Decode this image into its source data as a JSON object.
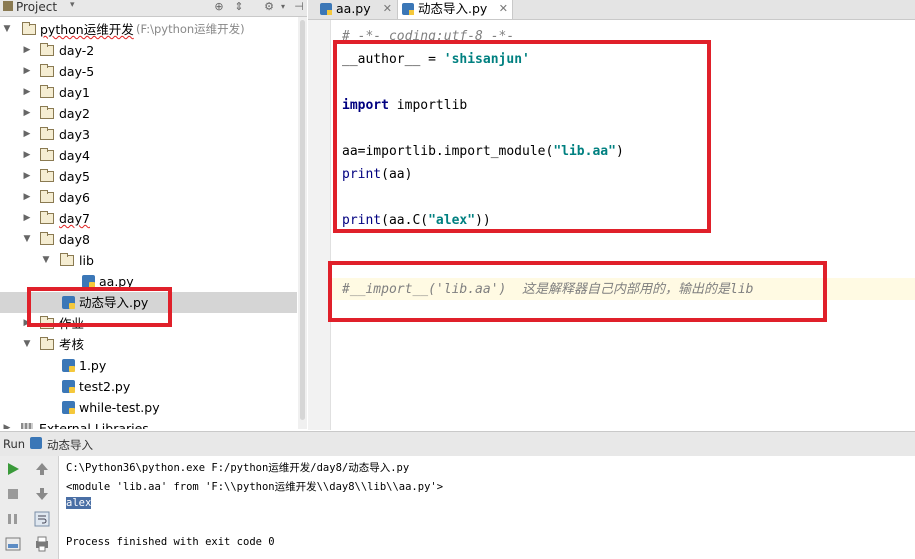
{
  "project_panel": {
    "title": "Project",
    "tree": [
      {
        "label": "python运维开发",
        "suffix": "(F:\\python运维开发)",
        "type": "root",
        "expanded": true
      },
      {
        "label": "day-2",
        "type": "folder"
      },
      {
        "label": "day-5",
        "type": "folder"
      },
      {
        "label": "day1",
        "type": "folder"
      },
      {
        "label": "day2",
        "type": "folder"
      },
      {
        "label": "day3",
        "type": "folder"
      },
      {
        "label": "day4",
        "type": "folder"
      },
      {
        "label": "day5",
        "type": "folder"
      },
      {
        "label": "day6",
        "type": "folder"
      },
      {
        "label": "day7",
        "type": "folder"
      },
      {
        "label": "day8",
        "type": "folder",
        "expanded": true
      },
      {
        "label": "lib",
        "type": "folder",
        "expanded": true
      },
      {
        "label": "aa.py",
        "type": "file"
      },
      {
        "label": "动态导入.py",
        "type": "file",
        "selected": true
      },
      {
        "label": "作业",
        "type": "folder"
      },
      {
        "label": "考核",
        "type": "folder",
        "expanded": true
      },
      {
        "label": "1.py",
        "type": "file"
      },
      {
        "label": "test2.py",
        "type": "file"
      },
      {
        "label": "while-test.py",
        "type": "file"
      },
      {
        "label": "External Libraries",
        "type": "library"
      }
    ]
  },
  "editor": {
    "tabs": [
      {
        "label": "aa.py",
        "active": false
      },
      {
        "label": "动态导入.py",
        "active": true
      }
    ],
    "code": {
      "line1": "# -*- coding:utf-8 -*-",
      "author_lhs": "__author__ = ",
      "author_str": "'shisanjun'",
      "import_kw": "import",
      "import_mod": " importlib",
      "aa_lhs": "aa=importlib.import_module(",
      "aa_str": "\"lib.aa\"",
      "aa_rhs": ")",
      "print1_fn": "print",
      "print1_arg": "(aa)",
      "print2_fn": "print",
      "print2_pre": "(aa.C(",
      "print2_str": "\"alex\"",
      "print2_post": "))",
      "comment": "#__import__('lib.aa')  这是解释器自己内部用的，输出的是lib"
    }
  },
  "run_panel": {
    "title": "Run",
    "config": "动态导入",
    "output": [
      "C:\\Python36\\python.exe F:/python运维开发/day8/动态导入.py",
      "<module 'lib.aa' from 'F:\\\\python运维开发\\\\day8\\\\lib\\\\aa.py'>",
      "alex",
      "",
      "Process finished with exit code 0"
    ]
  },
  "colors": {
    "annotation_red": "#e0202a",
    "keyword": "#000080",
    "string": "#008080",
    "comment": "#808080",
    "selection": "#d5d5d5",
    "run_green": "#3a9a3a"
  }
}
